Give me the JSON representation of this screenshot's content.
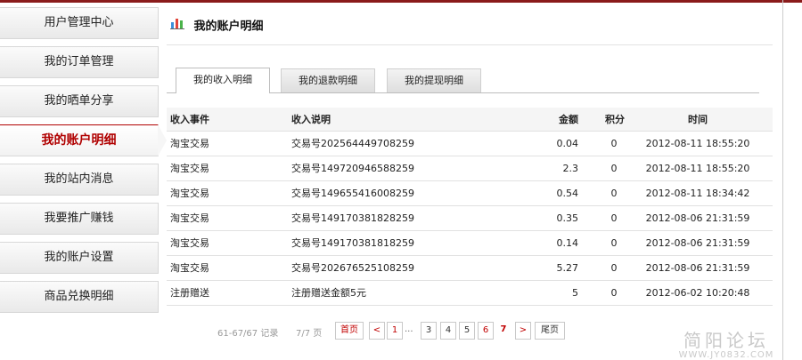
{
  "sidebar": {
    "items": [
      {
        "label": "用户管理中心",
        "active": false
      },
      {
        "label": "我的订单管理",
        "active": false
      },
      {
        "label": "我的晒单分享",
        "active": false
      },
      {
        "label": "我的账户明细",
        "active": true
      },
      {
        "label": "我的站内消息",
        "active": false
      },
      {
        "label": "我要推广赚钱",
        "active": false
      },
      {
        "label": "我的账户设置",
        "active": false
      },
      {
        "label": "商品兑换明细",
        "active": false
      }
    ]
  },
  "main": {
    "title": "我的账户明细",
    "title_icon": "bar-chart-icon",
    "tabs": [
      {
        "label": "我的收入明细",
        "active": true
      },
      {
        "label": "我的退款明细",
        "active": false
      },
      {
        "label": "我的提现明细",
        "active": false
      }
    ]
  },
  "table": {
    "headers": [
      "收入事件",
      "收入说明",
      "金额",
      "积分",
      "时间"
    ],
    "rows": [
      [
        "淘宝交易",
        "交易号202564449708259",
        "0.04",
        "0",
        "2012-08-11 18:55:20"
      ],
      [
        "淘宝交易",
        "交易号149720946588259",
        "2.3",
        "0",
        "2012-08-11 18:55:20"
      ],
      [
        "淘宝交易",
        "交易号149655416008259",
        "0.54",
        "0",
        "2012-08-11 18:34:42"
      ],
      [
        "淘宝交易",
        "交易号149170381828259",
        "0.35",
        "0",
        "2012-08-06 21:31:59"
      ],
      [
        "淘宝交易",
        "交易号149170381818259",
        "0.14",
        "0",
        "2012-08-06 21:31:59"
      ],
      [
        "淘宝交易",
        "交易号202676525108259",
        "5.27",
        "0",
        "2012-08-06 21:31:59"
      ],
      [
        "注册赠送",
        "注册赠送金额5元",
        "5",
        "0",
        "2012-06-02 10:20:48"
      ]
    ]
  },
  "pager": {
    "records": "61-67/67 记录",
    "pages": "7/7 页",
    "first": "首页",
    "prev": "<",
    "page1": "1",
    "ellipsis": "...",
    "page3": "3",
    "page4": "4",
    "page5": "5",
    "page6": "6",
    "page7": "7",
    "next": ">",
    "last": "尾页"
  },
  "watermark": {
    "title": "简阳论坛",
    "url": "WWW.JY0832.COM"
  },
  "colors": {
    "accent": "#b00000",
    "topbar": "#8a1b1b"
  }
}
